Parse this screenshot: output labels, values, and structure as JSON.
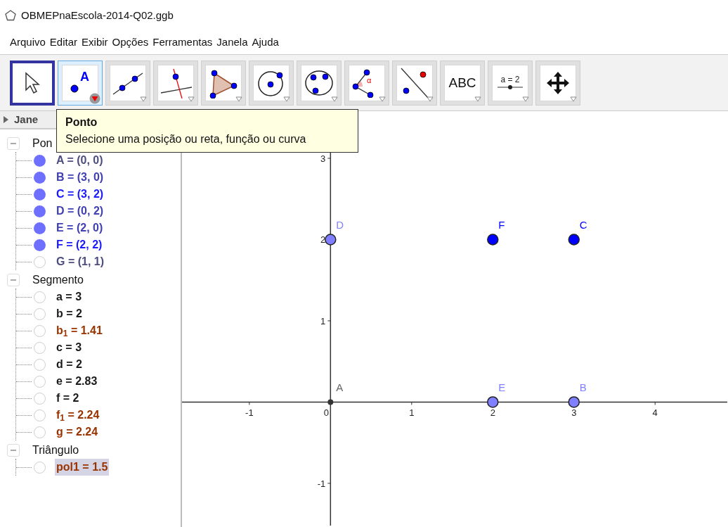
{
  "window": {
    "title": "OBMEPnaEscola-2014-Q02.ggb"
  },
  "menu": [
    "Arquivo",
    "Editar",
    "Exibir",
    "Opções",
    "Ferramentas",
    "Janela",
    "Ajuda"
  ],
  "tools": [
    {
      "kind": "move",
      "selected": true,
      "hovered": false
    },
    {
      "kind": "point",
      "selected": false,
      "hovered": true,
      "text": "A"
    },
    {
      "kind": "line",
      "selected": false,
      "hovered": false
    },
    {
      "kind": "perpendicular",
      "selected": false,
      "hovered": false
    },
    {
      "kind": "polygon",
      "selected": false,
      "hovered": false
    },
    {
      "kind": "circle",
      "selected": false,
      "hovered": false
    },
    {
      "kind": "conic",
      "selected": false,
      "hovered": false
    },
    {
      "kind": "angle",
      "selected": false,
      "hovered": false,
      "text": "α"
    },
    {
      "kind": "reflect",
      "selected": false,
      "hovered": false
    },
    {
      "kind": "text",
      "selected": false,
      "hovered": false,
      "text": "ABC"
    },
    {
      "kind": "slider",
      "selected": false,
      "hovered": false,
      "text": "a = 2"
    },
    {
      "kind": "pan",
      "selected": false,
      "hovered": false
    }
  ],
  "tooltip": {
    "title": "Ponto",
    "text": "Selecione uma posição ou reta, função ou curva"
  },
  "algebra": {
    "header": "Jane",
    "expanded": false,
    "groups": [
      {
        "label": "Pon",
        "expanded": true,
        "children": [
          {
            "text": "A = (0, 0)",
            "visible": true,
            "color": "#4d4d80",
            "selected": false
          },
          {
            "text": "B = (3, 0)",
            "visible": true,
            "color": "#4040b3",
            "selected": false
          },
          {
            "text": "C = (3, 2)",
            "visible": true,
            "color": "#1a1aff",
            "selected": false
          },
          {
            "text": "D = (0, 2)",
            "visible": true,
            "color": "#4040b3",
            "selected": false
          },
          {
            "text": "E = (2, 0)",
            "visible": true,
            "color": "#4040b3",
            "selected": false
          },
          {
            "text": "F = (2, 2)",
            "visible": true,
            "color": "#1a1aff",
            "selected": false
          },
          {
            "text": "G = (1, 1)",
            "visible": false,
            "color": "#4d4d80",
            "selected": false
          }
        ]
      },
      {
        "label": "Segmento",
        "expanded": true,
        "children": [
          {
            "text": "a = 3",
            "visible": false,
            "color": "#1a1a1a",
            "selected": false
          },
          {
            "text": "b = 2",
            "visible": false,
            "color": "#1a1a1a",
            "selected": false
          },
          {
            "text": "b$_{1}$ = 1.41",
            "visible": false,
            "color": "#993300",
            "selected": false
          },
          {
            "text": "c = 3",
            "visible": false,
            "color": "#1a1a1a",
            "selected": false
          },
          {
            "text": "d = 2",
            "visible": false,
            "color": "#1a1a1a",
            "selected": false
          },
          {
            "text": "e = 2.83",
            "visible": false,
            "color": "#1a1a1a",
            "selected": false
          },
          {
            "text": "f = 2",
            "visible": false,
            "color": "#1a1a1a",
            "selected": false
          },
          {
            "text": "f$_{1}$ = 2.24",
            "visible": false,
            "color": "#993300",
            "selected": false
          },
          {
            "text": "g = 2.24",
            "visible": false,
            "color": "#993300",
            "selected": false
          }
        ]
      },
      {
        "label": "Triângulo",
        "expanded": true,
        "children": [
          {
            "text": "pol1 = 1.5",
            "visible": false,
            "color": "#993300",
            "selected": true
          }
        ]
      }
    ]
  },
  "graphics": {
    "chart_data": {
      "type": "scatter",
      "xlim": [
        -1.83,
        4.89
      ],
      "ylim": [
        -1.52,
        3.58
      ],
      "xticks": [
        -1,
        0,
        1,
        2,
        3,
        4
      ],
      "yticks": [
        -1,
        1,
        2,
        3
      ],
      "series": [
        {
          "name": "D",
          "color": "#7f7fff",
          "x": [
            0
          ],
          "values": [
            2
          ]
        },
        {
          "name": "F",
          "color": "#0000ff",
          "x": [
            2
          ],
          "values": [
            2
          ]
        },
        {
          "name": "C",
          "color": "#0000ff",
          "x": [
            3
          ],
          "values": [
            2
          ]
        },
        {
          "name": "A",
          "color": "#333333",
          "x": [
            0
          ],
          "values": [
            0
          ]
        },
        {
          "name": "E",
          "color": "#7f7fff",
          "x": [
            2
          ],
          "values": [
            0
          ]
        },
        {
          "name": "B",
          "color": "#7f7fff",
          "x": [
            3
          ],
          "values": [
            0
          ]
        }
      ]
    },
    "markers": [
      {
        "kind": "point"
      },
      {
        "kind": "point"
      },
      {
        "kind": "point"
      },
      {
        "kind": "dot"
      },
      {
        "kind": "point"
      },
      {
        "kind": "point"
      }
    ]
  }
}
